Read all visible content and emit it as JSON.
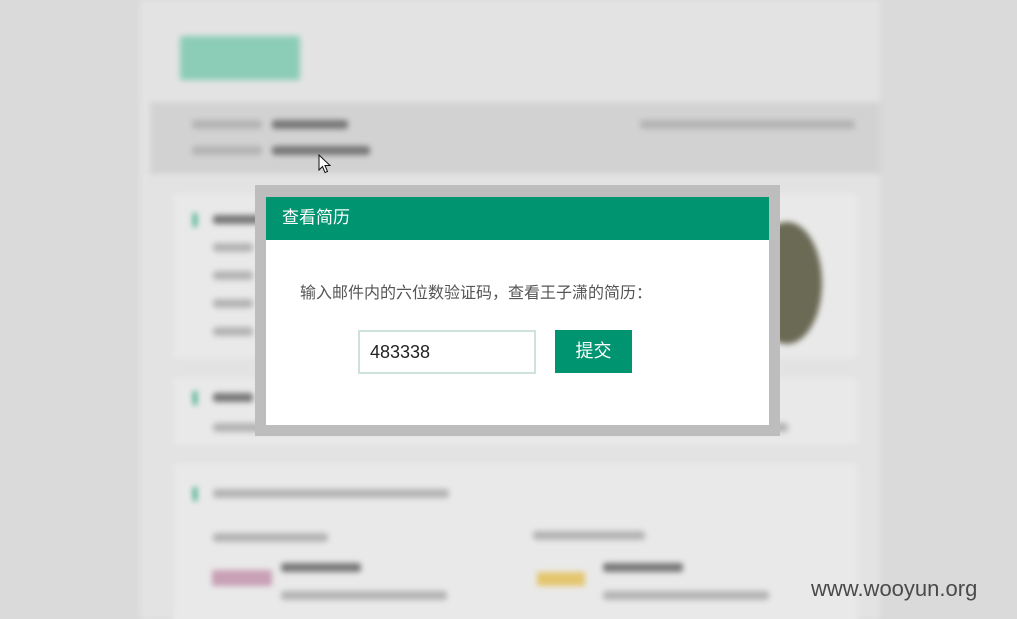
{
  "modal": {
    "title": "查看简历",
    "message": "输入邮件内的六位数验证码，查看王子潇的简历：",
    "code_value": "483338",
    "submit_label": "提交"
  },
  "watermark": "www.wooyun.org",
  "colors": {
    "accent": "#009470",
    "overlay_bg": "#dadada",
    "modal_frame": "#bdbdbd"
  },
  "icons": [
    "mouse-cursor-icon"
  ]
}
